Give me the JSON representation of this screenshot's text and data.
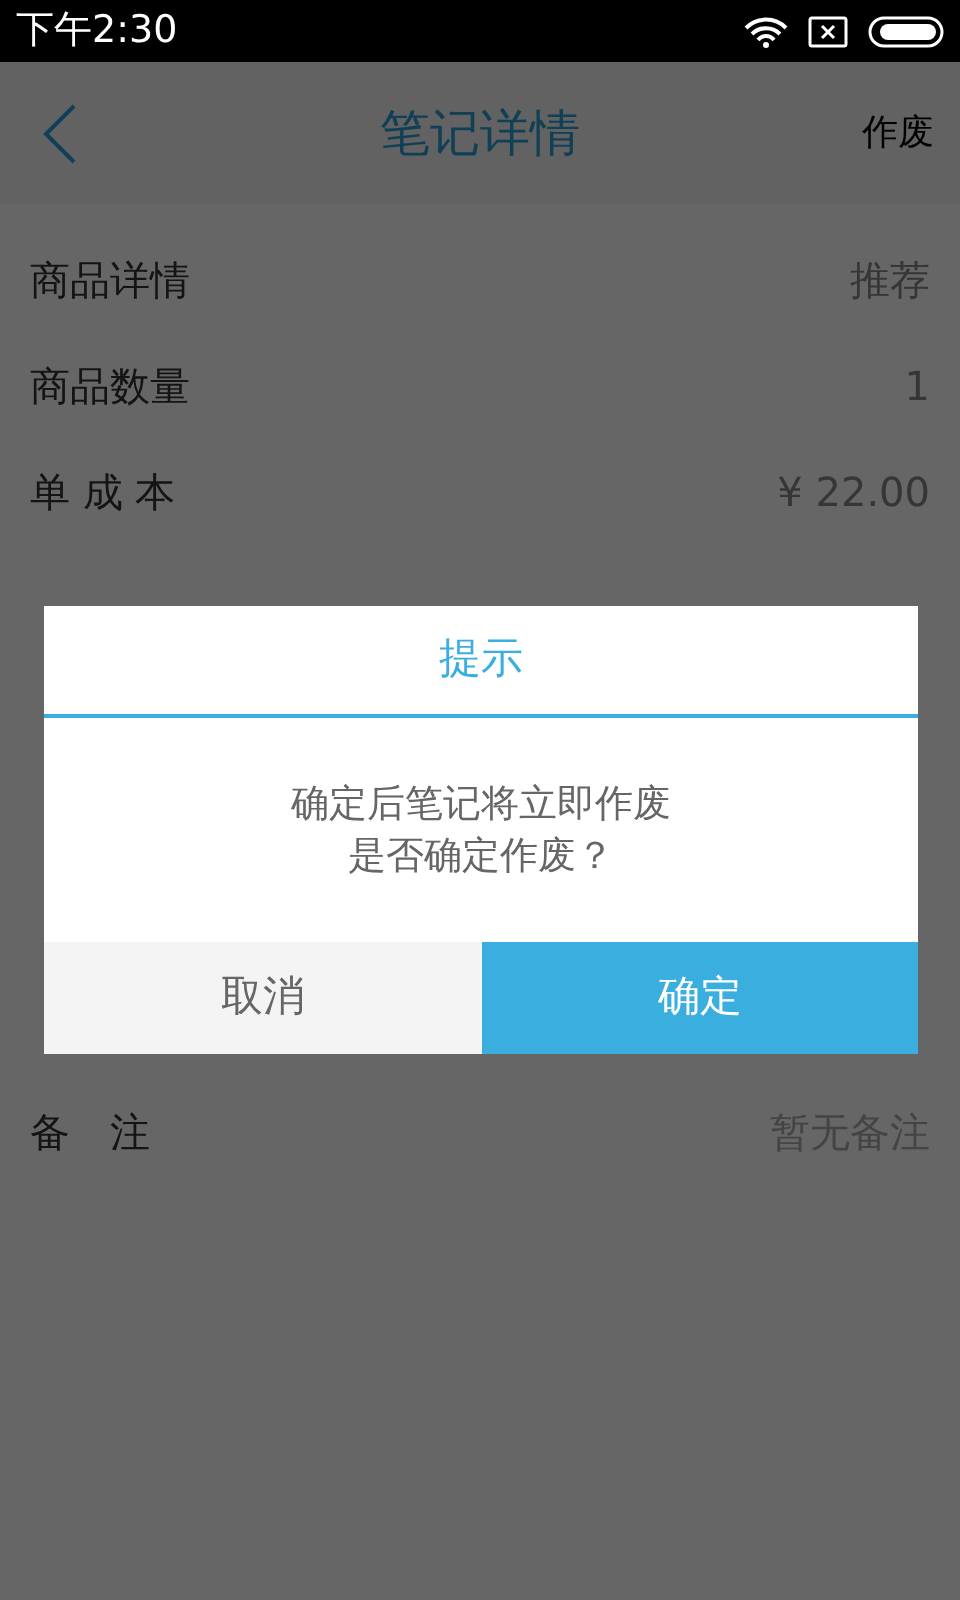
{
  "status_bar": {
    "time": "下午2:30"
  },
  "header": {
    "title": "笔记详情",
    "action": "作废"
  },
  "rows": [
    {
      "label": "商品详情",
      "value": "推荐"
    },
    {
      "label": "商品数量",
      "value": "1"
    },
    {
      "label": "单 成 本",
      "value": "¥ 22.00"
    }
  ],
  "remark_row": {
    "label": "备　注",
    "value": "暂无备注"
  },
  "dialog": {
    "title": "提示",
    "message_lines": [
      "确定后笔记将立即作废",
      "是否确定作废？"
    ],
    "buttons": [
      {
        "label": "取消",
        "kind": "cancel"
      },
      {
        "label": "确定",
        "kind": "confirm"
      }
    ]
  }
}
